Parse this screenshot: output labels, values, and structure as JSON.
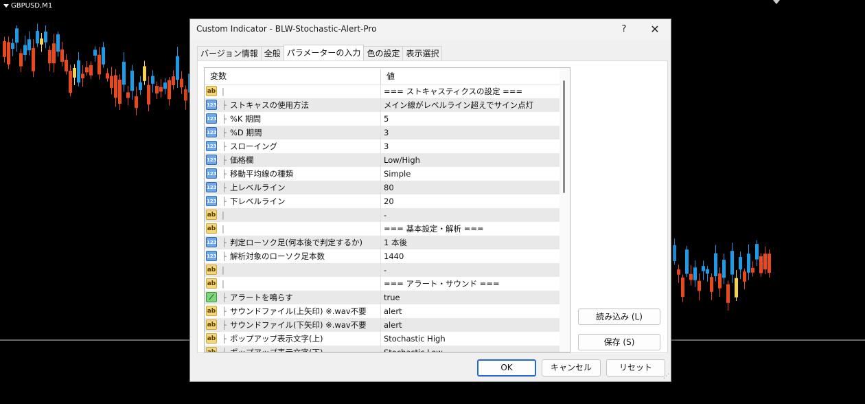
{
  "chart": {
    "symbol": "GBPUSD,M1",
    "colors": {
      "background": "#000000",
      "bull": "#1e9be6",
      "bear": "#e8491d",
      "doji": "#f5d44b",
      "hline": "#cfcfcf"
    }
  },
  "dialog": {
    "title": "Custom Indicator - BLW-Stochastic-Alert-Pro",
    "help": "?",
    "close": "✕",
    "tabs": [
      "バージョン情報",
      "全般",
      "パラメーターの入力",
      "色の設定",
      "表示選択"
    ],
    "active_tab": 2,
    "grid": {
      "header_var": "変数",
      "header_val": "値",
      "rows": [
        {
          "icon": "ab",
          "icon_name": "string-type-icon",
          "tree": "|",
          "var": "",
          "val": "=== ストキャスティクスの設定 ==="
        },
        {
          "icon": "123",
          "icon_name": "integer-type-icon",
          "tree": "├",
          "var": "ストキャスの使用方法",
          "val": "メイン線がレベルライン超えでサイン点灯"
        },
        {
          "icon": "123",
          "icon_name": "integer-type-icon",
          "tree": "├",
          "var": "%K 期間",
          "val": "5"
        },
        {
          "icon": "123",
          "icon_name": "integer-type-icon",
          "tree": "├",
          "var": "%D 期間",
          "val": "3"
        },
        {
          "icon": "123",
          "icon_name": "integer-type-icon",
          "tree": "├",
          "var": "スローイング",
          "val": "3"
        },
        {
          "icon": "123",
          "icon_name": "integer-type-icon",
          "tree": "├",
          "var": "価格欄",
          "val": "Low/High"
        },
        {
          "icon": "123",
          "icon_name": "integer-type-icon",
          "tree": "├",
          "var": "移動平均線の種類",
          "val": "Simple"
        },
        {
          "icon": "123",
          "icon_name": "integer-type-icon",
          "tree": "├",
          "var": "上レベルライン",
          "val": "80"
        },
        {
          "icon": "123",
          "icon_name": "integer-type-icon",
          "tree": "├",
          "var": "下レベルライン",
          "val": "20"
        },
        {
          "icon": "ab",
          "icon_name": "string-type-icon",
          "tree": "|",
          "var": "",
          "val": "-"
        },
        {
          "icon": "ab",
          "icon_name": "string-type-icon",
          "tree": "|",
          "var": "",
          "val": "=== 基本設定・解析 ==="
        },
        {
          "icon": "123",
          "icon_name": "integer-type-icon",
          "tree": "├",
          "var": "判定ローソク足(何本後で判定するか)",
          "val": " 1 本後"
        },
        {
          "icon": "123",
          "icon_name": "integer-type-icon",
          "tree": "├",
          "var": "解析対象のローソク足本数",
          "val": "1440"
        },
        {
          "icon": "ab",
          "icon_name": "string-type-icon",
          "tree": "|",
          "var": "",
          "val": "-"
        },
        {
          "icon": "ab",
          "icon_name": "string-type-icon",
          "tree": "|",
          "var": "",
          "val": "=== アラート・サウンド ==="
        },
        {
          "icon": "bool",
          "icon_name": "boolean-type-icon",
          "tree": "├",
          "var": "アラートを鳴らす",
          "val": "true"
        },
        {
          "icon": "ab",
          "icon_name": "string-type-icon",
          "tree": "├",
          "var": "サウンドファイル(上矢印) ※.wav不要",
          "val": "alert"
        },
        {
          "icon": "ab",
          "icon_name": "string-type-icon",
          "tree": "├",
          "var": "サウンドファイル(下矢印) ※.wav不要",
          "val": "alert"
        },
        {
          "icon": "ab",
          "icon_name": "string-type-icon",
          "tree": "├",
          "var": "ポップアップ表示文字(上)",
          "val": "Stochastic High"
        },
        {
          "icon": "ab",
          "icon_name": "string-type-icon",
          "tree": "├",
          "var": "ポップアップ表示文字(下)",
          "val": "Stochastic Low"
        }
      ]
    },
    "buttons": {
      "load": "読み込み (L)",
      "save": "保存 (S)",
      "ok": "OK",
      "cancel": "キャンセル",
      "reset": "リセット"
    }
  }
}
